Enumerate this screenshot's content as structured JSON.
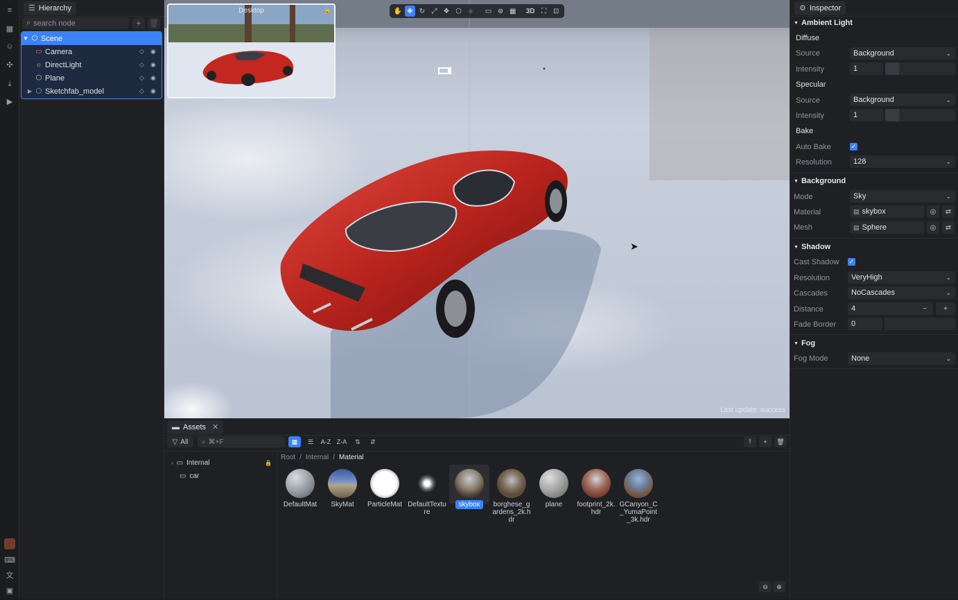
{
  "rail": {
    "icons": [
      "menu-icon",
      "grid-icon",
      "user-icon",
      "puzzle-icon",
      "download-icon",
      "play-icon",
      "avatar",
      "keyboard-icon",
      "language-icon",
      "layout-icon"
    ]
  },
  "hierarchy": {
    "tab_label": "Hierarchy",
    "search_placeholder": "search node",
    "nodes": [
      {
        "label": "Scene",
        "icon": "scene-icon"
      },
      {
        "label": "Camera",
        "icon": "camera-icon"
      },
      {
        "label": "DirectLight",
        "icon": "light-icon"
      },
      {
        "label": "Plane",
        "icon": "mesh-icon"
      },
      {
        "label": "Sketchfab_model",
        "icon": "mesh-icon"
      }
    ]
  },
  "viewport": {
    "preview_title": "Desktop",
    "status": "Last update: success",
    "toolbar": {
      "mode_3d": "3D"
    }
  },
  "inspector": {
    "tab_label": "Inspector",
    "ambient": {
      "title": "Ambient Light",
      "diffuse_title": "Diffuse",
      "diffuse_source_label": "Source",
      "diffuse_source_value": "Background",
      "diffuse_intensity_label": "Intensity",
      "diffuse_intensity_value": "1",
      "specular_title": "Specular",
      "specular_source_label": "Source",
      "specular_source_value": "Background",
      "specular_intensity_label": "Intensity",
      "specular_intensity_value": "1",
      "bake_title": "Bake",
      "auto_bake_label": "Auto Bake",
      "auto_bake_checked": true,
      "resolution_label": "Resolution",
      "resolution_value": "128"
    },
    "background": {
      "title": "Background",
      "mode_label": "Mode",
      "mode_value": "Sky",
      "material_label": "Material",
      "material_value": "skybox",
      "mesh_label": "Mesh",
      "mesh_value": "Sphere"
    },
    "shadow": {
      "title": "Shadow",
      "cast_label": "Cast Shadow",
      "cast_checked": true,
      "resolution_label": "Resolution",
      "resolution_value": "VeryHigh",
      "cascades_label": "Cascades",
      "cascades_value": "NoCascades",
      "distance_label": "Distance",
      "distance_value": "4",
      "fade_label": "Fade Border",
      "fade_value": "0"
    },
    "fog": {
      "title": "Fog",
      "mode_label": "Fog Mode",
      "mode_value": "None"
    }
  },
  "assets": {
    "tab_label": "Assets",
    "filter_label": "All",
    "search_placeholder": "⌘+F",
    "sort_az": "A-Z",
    "sort_za": "Z-A",
    "folders": [
      {
        "label": "Internal",
        "locked": true
      },
      {
        "label": "car",
        "locked": false
      }
    ],
    "breadcrumb": [
      "Root",
      "Internal",
      "Material"
    ],
    "items": [
      {
        "label": "DefaultMat",
        "selected": false,
        "color": "#9aa0a8"
      },
      {
        "label": "SkyMat",
        "selected": false,
        "color": "#6f86b3"
      },
      {
        "label": "ParticleMat",
        "selected": false,
        "color": "#ffffff"
      },
      {
        "label": "DefaultTexture",
        "selected": false,
        "color": "#ffffff"
      },
      {
        "label": "skybox",
        "selected": true,
        "color": "#8a7a6a"
      },
      {
        "label": "borghese_gardens_2k.hdr",
        "selected": false,
        "color": "#7a6a58"
      },
      {
        "label": "plane",
        "selected": false,
        "color": "#a8a8a8"
      },
      {
        "label": "footprint_2k.hdr",
        "selected": false,
        "color": "#8a5c4c"
      },
      {
        "label": "GCanyon_C_YumaPoint_3k.hdr",
        "selected": false,
        "color": "#6e7a8e"
      }
    ]
  },
  "colors": {
    "accent": "#3b82f6",
    "panel": "#1f2023",
    "background": "#1b1c1e"
  }
}
